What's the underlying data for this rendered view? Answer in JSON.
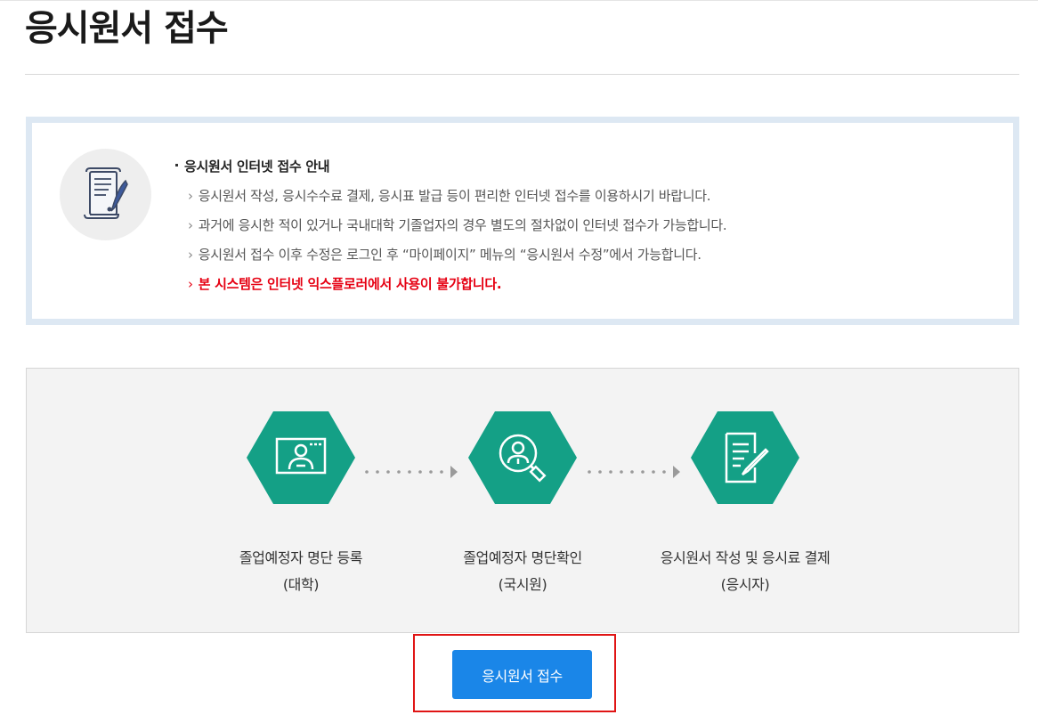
{
  "page": {
    "title": "응시원서 접수"
  },
  "notice": {
    "icon": "document-quill-icon",
    "heading": "응시원서 인터넷 접수 안내",
    "bullet_glyph": "›",
    "lines": [
      "응시원서 작성, 응시수수료 결제, 응시표 발급 등이 편리한 인터넷 접수를 이용하시기 바랍니다.",
      "과거에 응시한 적이 있거나 국내대학 기졸업자의 경우 별도의 절차없이 인터넷 접수가 가능합니다.",
      "응시원서 접수 이후 수정은 로그인 후 “마이페이지” 메뉴의 “응시원서 수정”에서 가능합니다.",
      "본 시스템은 인터넷 익스플로러에서 사용이 불가합니다."
    ],
    "warning_color": "#e60012"
  },
  "process": {
    "accent_color": "#14a086",
    "steps": [
      {
        "icon": "monitor-user-icon",
        "label": "졸업예정자 명단 등록",
        "sub": "(대학)"
      },
      {
        "icon": "magnifier-user-icon",
        "label": "졸업예정자 명단확인",
        "sub": "(국시원)"
      },
      {
        "icon": "document-pen-icon",
        "label": "응시원서 작성 및 응시료 결제",
        "sub": "(응시자)"
      }
    ]
  },
  "actions": {
    "apply_label": "응시원서 접수",
    "apply_color": "#1a86e8",
    "highlight_color": "#e01515"
  }
}
